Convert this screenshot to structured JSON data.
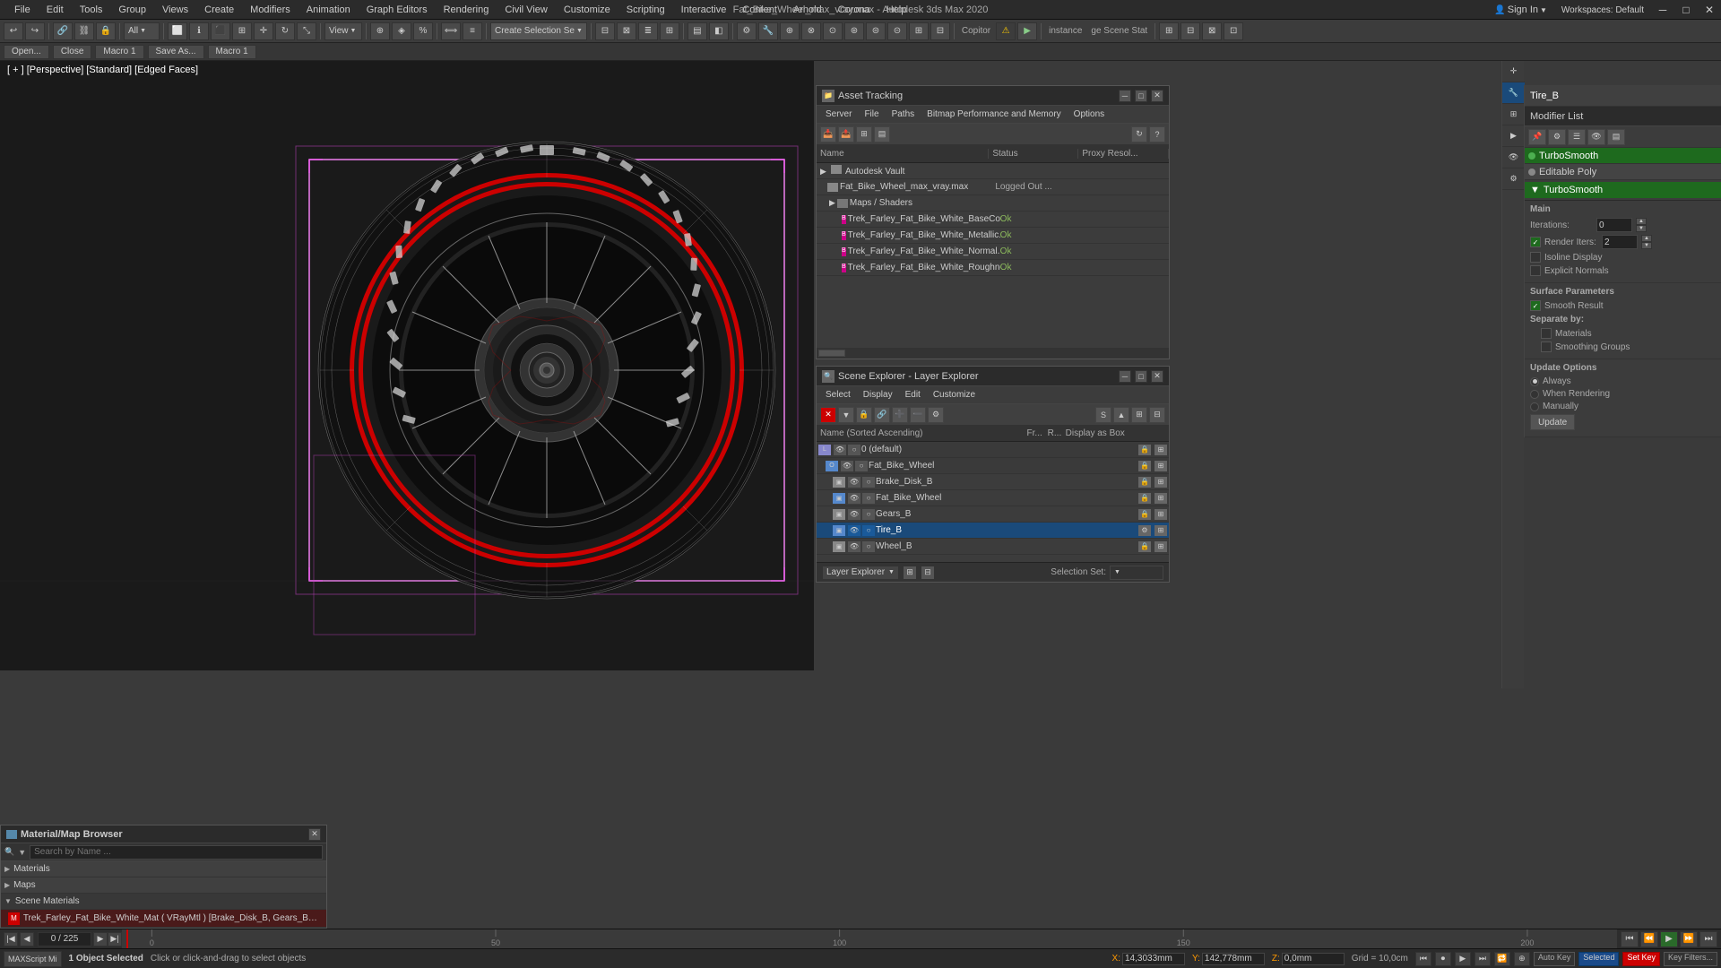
{
  "window": {
    "title": "Fat_Bike_Wheel_max_vray.max - Autodesk 3ds Max 2020"
  },
  "menus": {
    "items": [
      "File",
      "Edit",
      "Tools",
      "Group",
      "Views",
      "Create",
      "Modifiers",
      "Animation",
      "Graph Editors",
      "Rendering",
      "Civil View",
      "Customize",
      "Scripting",
      "Interactive",
      "Content",
      "Arnold",
      "Corona",
      "Help"
    ]
  },
  "toolbar": {
    "mode_dropdown": "All",
    "create_selection_btn": "Create Selection Se",
    "instance_label": "instance",
    "copitor_label": "Copitor",
    "scene_stat_label": "ge Scene Stat",
    "workspaces_label": "Workspaces: Default",
    "sign_in_label": "Sign In"
  },
  "viewport": {
    "label": "[ + ] [Perspective] [Standard] [Edged Faces]"
  },
  "macro_bar": {
    "open": "Open...",
    "close": "Close",
    "macro1_1": "Macro 1",
    "save_as": "Save As...",
    "macro1_2": "Macro 1"
  },
  "asset_tracking": {
    "title": "Asset Tracking",
    "menus": [
      "Server",
      "File",
      "Paths",
      "Bitmap Performance and Memory",
      "Options"
    ],
    "columns": [
      "Name",
      "Status",
      "Proxy Resol..."
    ],
    "rows": [
      {
        "indent": 0,
        "name": "Autodesk Vault",
        "status": "",
        "proxy": "",
        "icon": "vault"
      },
      {
        "indent": 1,
        "name": "Fat_Bike_Wheel_max_vray.max",
        "status": "Logged Out ...",
        "proxy": "",
        "icon": "file"
      },
      {
        "indent": 1,
        "name": "Maps / Shaders",
        "status": "",
        "proxy": "",
        "icon": "folder"
      },
      {
        "indent": 2,
        "name": "Trek_Farley_Fat_Bike_White_BaseColor.png",
        "status": "Ok",
        "proxy": "",
        "icon": "img"
      },
      {
        "indent": 2,
        "name": "Trek_Farley_Fat_Bike_White_Metallic.png",
        "status": "Ok",
        "proxy": "",
        "icon": "img"
      },
      {
        "indent": 2,
        "name": "Trek_Farley_Fat_Bike_White_Normal.png",
        "status": "Ok",
        "proxy": "",
        "icon": "img"
      },
      {
        "indent": 2,
        "name": "Trek_Farley_Fat_Bike_White_Roughness.png",
        "status": "Ok",
        "proxy": "",
        "icon": "img"
      }
    ]
  },
  "scene_explorer": {
    "title": "Scene Explorer - Layer Explorer",
    "menus": [
      "Select",
      "Display",
      "Edit",
      "Customize"
    ],
    "columns": [
      "Name (Sorted Ascending)",
      "Fr...",
      "R...",
      "Display as Box"
    ],
    "rows": [
      {
        "indent": 0,
        "name": "0 (default)",
        "selected": false,
        "icon": "layer"
      },
      {
        "indent": 1,
        "name": "Fat_Bike_Wheel",
        "selected": false,
        "icon": "obj-blue"
      },
      {
        "indent": 2,
        "name": "Brake_Disk_B",
        "selected": false,
        "icon": "obj"
      },
      {
        "indent": 2,
        "name": "Fat_Bike_Wheel",
        "selected": false,
        "icon": "obj-cube"
      },
      {
        "indent": 2,
        "name": "Gears_B",
        "selected": false,
        "icon": "obj"
      },
      {
        "indent": 2,
        "name": "Tire_B",
        "selected": true,
        "icon": "obj-blue"
      },
      {
        "indent": 2,
        "name": "Wheel_B",
        "selected": false,
        "icon": "obj"
      }
    ],
    "footer_label": "Layer Explorer",
    "selection_set_label": "Selection Set:"
  },
  "modifier_panel": {
    "object_name": "Tire_B",
    "title": "Modifier List",
    "modifiers": [
      {
        "name": "TurboSmooth",
        "active": true
      },
      {
        "name": "Editable Poly",
        "active": false
      }
    ],
    "turbosmooth": {
      "title": "TurboSmooth",
      "main_label": "Main",
      "iterations_label": "Iterations:",
      "iterations_val": "0",
      "render_iters_label": "Render Iters:",
      "render_iters_val": "2",
      "isoline_label": "Isoline Display",
      "explicit_label": "Explicit Normals",
      "surface_params_label": "Surface Parameters",
      "smooth_result_label": "Smooth Result",
      "separate_by_label": "Separate by:",
      "materials_label": "Materials",
      "smoothing_groups_label": "Smoothing Groups",
      "update_options_label": "Update Options",
      "always_label": "Always",
      "when_rendering_label": "When Rendering",
      "manually_label": "Manually",
      "update_btn_label": "Update"
    }
  },
  "mat_browser": {
    "title": "Material/Map Browser",
    "search_placeholder": "Search by Name ...",
    "sections": [
      {
        "label": "Materials",
        "expanded": false
      },
      {
        "label": "Maps",
        "expanded": false
      },
      {
        "label": "Scene Materials",
        "expanded": true
      }
    ],
    "scene_materials": [
      {
        "name": "Trek_Farley_Fat_Bike_White_Mat ( VRayMtl ) [Brake_Disk_B, Gears_B, Tire_B...",
        "icon": "mat"
      }
    ]
  },
  "timeline": {
    "frame_current": "0 / 225",
    "ticks": [
      "0",
      "50",
      "100",
      "150",
      "200"
    ]
  },
  "status_bar": {
    "maxscript_label": "MAXScript Mi",
    "status_msg": "1 Object Selected",
    "hint_msg": "Click or click-and-drag to select objects",
    "x_label": "X:",
    "x_val": "14,3033mm",
    "y_label": "Y:",
    "y_val": "142,778mm",
    "z_label": "Z:",
    "z_val": "0,0mm",
    "grid_label": "Grid = 10,0cm",
    "auto_key_label": "Auto Key",
    "selected_label": "Selected",
    "set_key_label": "Set Key",
    "key_filters_label": "Key Filters..."
  }
}
